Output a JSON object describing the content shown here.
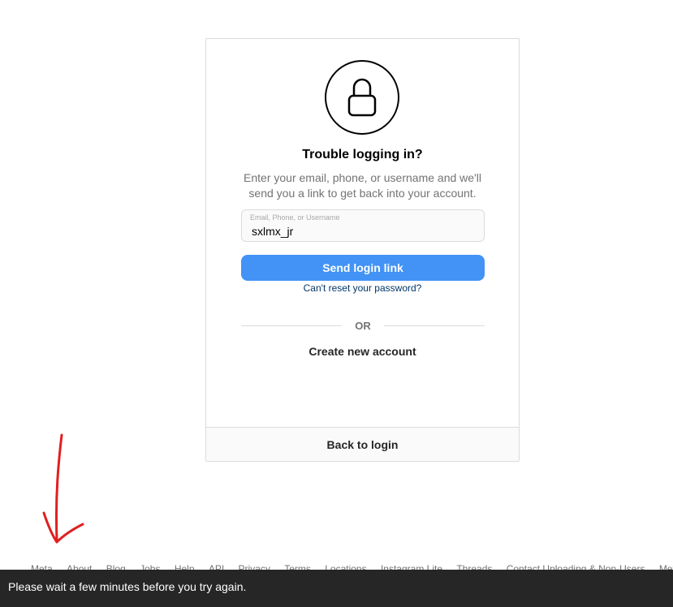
{
  "card": {
    "title": "Trouble logging in?",
    "subtitle": "Enter your email, phone, or username and we'll send you a link to get back into your account.",
    "field_label": "Email, Phone, or Username",
    "field_value": "sxlmx_jr",
    "send_button": "Send login link",
    "reset_link": "Can't reset your password?",
    "or_text": "OR",
    "create_account": "Create new account",
    "back_to_login": "Back to login"
  },
  "footer": {
    "links": [
      "Meta",
      "About",
      "Blog",
      "Jobs",
      "Help",
      "API",
      "Privacy",
      "Terms",
      "Locations",
      "Instagram Lite",
      "Threads",
      "Contact Uploading & Non-Users",
      "Meta Verified"
    ]
  },
  "toast": {
    "message": "Please wait a few minutes before you try again."
  },
  "icons": {
    "lock": "lock-icon",
    "annotation": "red-arrow-annotation"
  },
  "colors": {
    "primary_button": "#4293f5",
    "link": "#00376b",
    "toast_bg": "#262626",
    "annotation": "#e02020"
  }
}
